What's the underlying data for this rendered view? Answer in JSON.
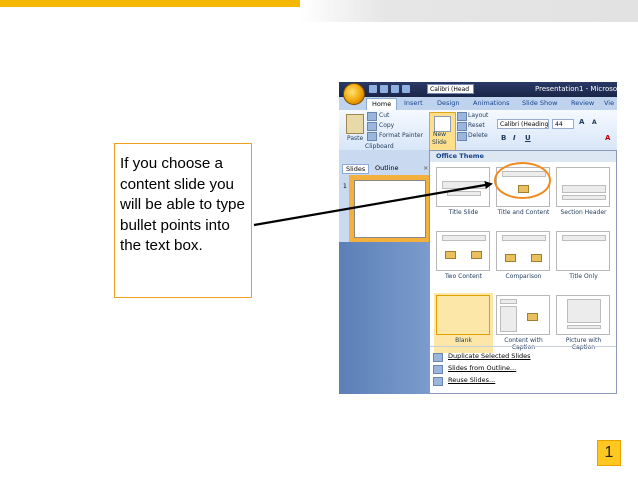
{
  "slide": {
    "callout_text": "If you choose a content slide you will be able to type bullet points into the text box.",
    "page_number": "1",
    "colors": {
      "accent": "#f5b800",
      "callout_border": "#f0a020",
      "highlight_ring": "#f08a20"
    }
  },
  "screenshot": {
    "window_title": "Presentation1 - Microso",
    "quick_access_font": "Calibri (Head",
    "tabs": [
      "Home",
      "Insert",
      "Design",
      "Animations",
      "Slide Show",
      "Review",
      "Vie"
    ],
    "ribbon": {
      "paste_label": "Paste",
      "cut_label": "Cut",
      "copy_label": "Copy",
      "format_painter_label": "Format Painter",
      "clipboard_group": "Clipboard",
      "new_slide_label": "New",
      "new_slide_label2": "Slide",
      "layout_label": "Layout",
      "reset_label": "Reset",
      "delete_label": "Delete",
      "font_name": "Calibri (Headings",
      "font_size": "44"
    },
    "panel_tabs": {
      "slides": "Slides",
      "outline": "Outline"
    },
    "slide_number": "1",
    "gallery_header": "Office Theme",
    "layouts": [
      {
        "label": "Title Slide"
      },
      {
        "label": "Title and Content"
      },
      {
        "label": "Section Header"
      },
      {
        "label": "Two Content"
      },
      {
        "label": "Comparison"
      },
      {
        "label": "Title Only"
      },
      {
        "label": "Blank"
      },
      {
        "label": "Content with Caption"
      },
      {
        "label": "Picture with Caption"
      }
    ],
    "menu_items": [
      "Duplicate Selected Slides",
      "Slides from Outline...",
      "Reuse Slides..."
    ]
  }
}
